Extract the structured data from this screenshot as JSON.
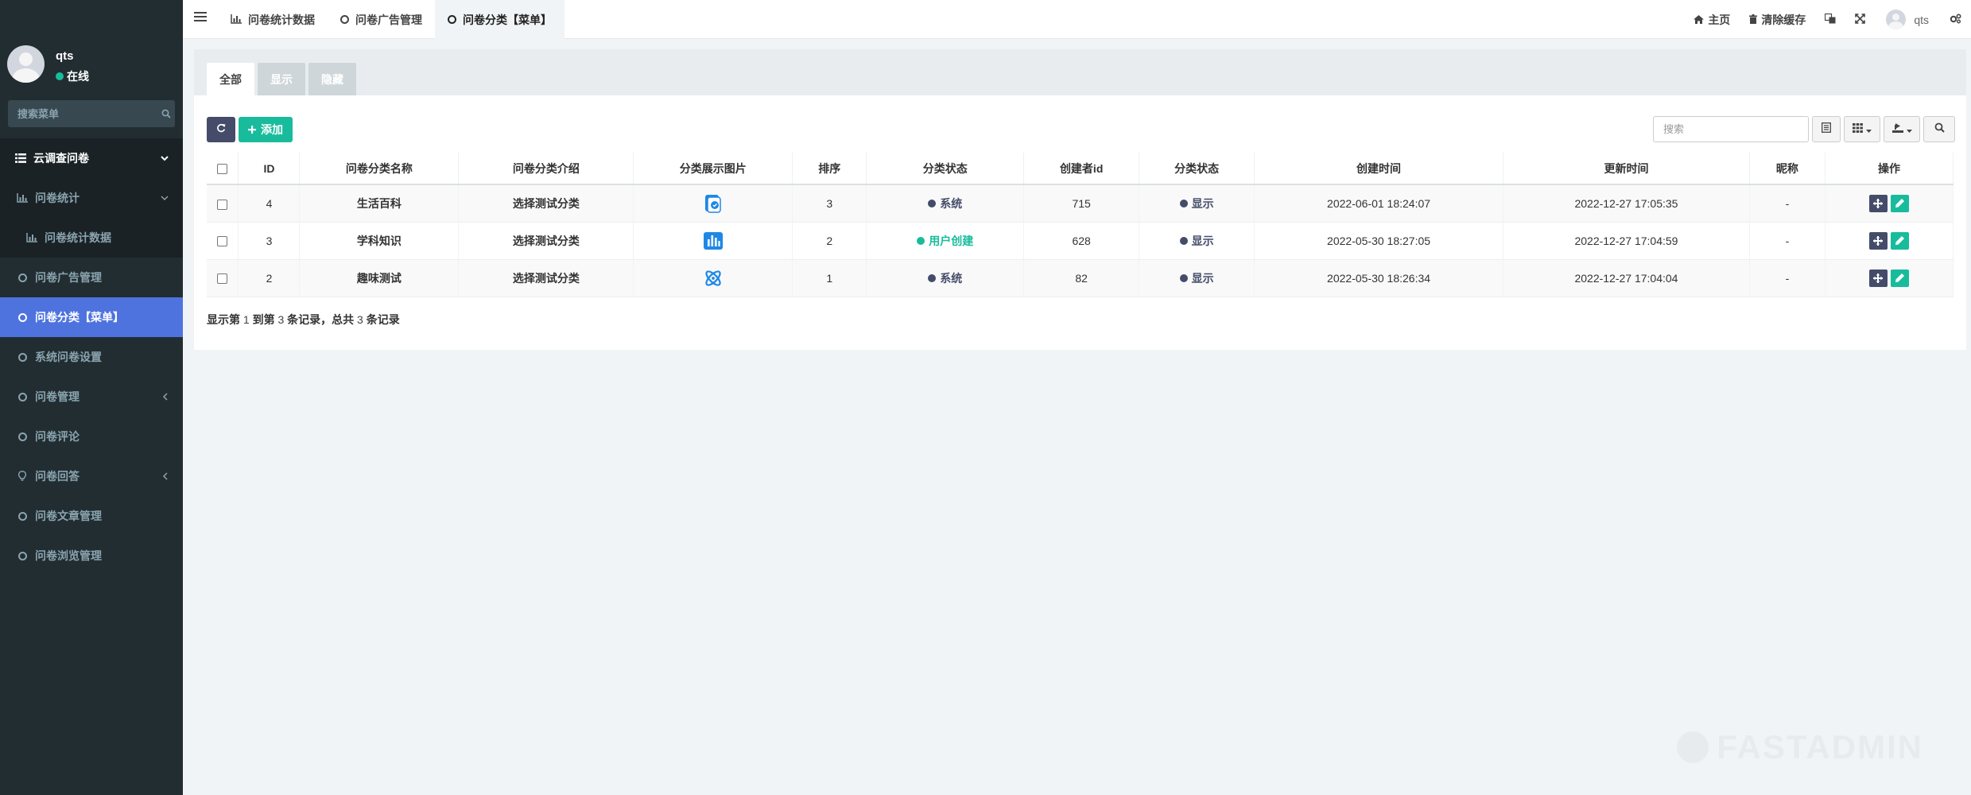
{
  "user": {
    "name": "qts",
    "status": "在线"
  },
  "sidebar": {
    "search_placeholder": "搜索菜单",
    "items": [
      {
        "label": "云调查问卷"
      },
      {
        "label": "问卷统计"
      },
      {
        "label": "问卷统计数据"
      },
      {
        "label": "问卷广告管理"
      },
      {
        "label": "问卷分类【菜单】"
      },
      {
        "label": "系统问卷设置"
      },
      {
        "label": "问卷管理"
      },
      {
        "label": "问卷评论"
      },
      {
        "label": "问卷回答"
      },
      {
        "label": "问卷文章管理"
      },
      {
        "label": "问卷浏览管理"
      }
    ]
  },
  "navbar": {
    "tabs": [
      {
        "label": "问卷统计数据"
      },
      {
        "label": "问卷广告管理"
      },
      {
        "label": "问卷分类【菜单】"
      }
    ],
    "home_label": "主页",
    "clear_cache_label": "清除缓存",
    "user_name": "qts"
  },
  "panel": {
    "filter_tabs": [
      {
        "label": "全部"
      },
      {
        "label": "显示"
      },
      {
        "label": "隐藏"
      }
    ],
    "add_label": "添加",
    "search_placeholder": "搜索"
  },
  "table": {
    "columns": [
      "ID",
      "问卷分类名称",
      "问卷分类介绍",
      "分类展示图片",
      "排序",
      "分类状态",
      "创建者id",
      "分类状态",
      "创建时间",
      "更新时间",
      "昵称",
      "操作"
    ],
    "rows": [
      {
        "id": "4",
        "name": "生活百科",
        "intro": "选择测试分类",
        "image_icon": "document-badge-icon",
        "sort": "3",
        "type_status": "系统",
        "creator_id": "715",
        "show_status": "显示",
        "created": "2022-06-01 18:24:07",
        "updated": "2022-12-27 17:05:35",
        "nickname": "-"
      },
      {
        "id": "3",
        "name": "学科知识",
        "intro": "选择测试分类",
        "image_icon": "bar-chart-icon",
        "sort": "2",
        "type_status": "用户创建",
        "creator_id": "628",
        "show_status": "显示",
        "created": "2022-05-30 18:27:05",
        "updated": "2022-12-27 17:04:59",
        "nickname": "-"
      },
      {
        "id": "2",
        "name": "趣味测试",
        "intro": "选择测试分类",
        "image_icon": "flower-icon",
        "sort": "1",
        "type_status": "系统",
        "creator_id": "82",
        "show_status": "显示",
        "created": "2022-05-30 18:26:34",
        "updated": "2022-12-27 17:04:04",
        "nickname": "-"
      }
    ]
  },
  "pagination": {
    "prefix": "显示第",
    "from": "1",
    "to_label": "到第",
    "to": "3",
    "mid_label": "条记录，总共",
    "total": "3",
    "suffix": "条记录"
  },
  "watermark": "FASTADMIN",
  "colors": {
    "sidebar_bg": "#222d32",
    "active_menu": "#4e73df",
    "success": "#18bc9c",
    "dark_button": "#444c69",
    "system_status": "#444c69",
    "user_created_status": "#18bc9c",
    "image_icon_blue": "#1e88e5"
  }
}
